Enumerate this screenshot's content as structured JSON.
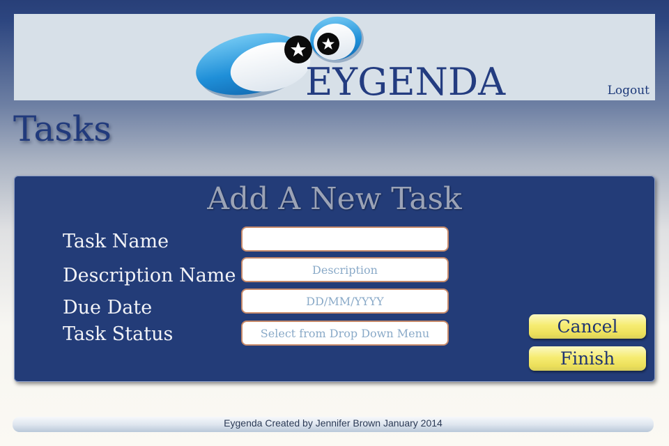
{
  "header": {
    "app_name": "EYGENDA",
    "logout_label": "Logout"
  },
  "page": {
    "title": "Tasks"
  },
  "form": {
    "title": "Add A New Task",
    "fields": [
      {
        "label": "Task Name",
        "value": "",
        "placeholder": ""
      },
      {
        "label": "Description Name",
        "value": "",
        "placeholder": "Description"
      },
      {
        "label": "Due Date",
        "value": "",
        "placeholder": "DD/MM/YYYY"
      },
      {
        "label": "Task Status",
        "value": "",
        "placeholder": "Select from Drop Down Menu"
      }
    ],
    "cancel_label": "Cancel",
    "finish_label": "Finish"
  },
  "footer": {
    "credit": "Eygenda Created by Jennifer Brown January 2014"
  },
  "colors": {
    "brand_blue": "#233c78",
    "title_blue": "#213a7c",
    "button_yellow": "#f6ec72",
    "field_border": "#c78a6a"
  }
}
